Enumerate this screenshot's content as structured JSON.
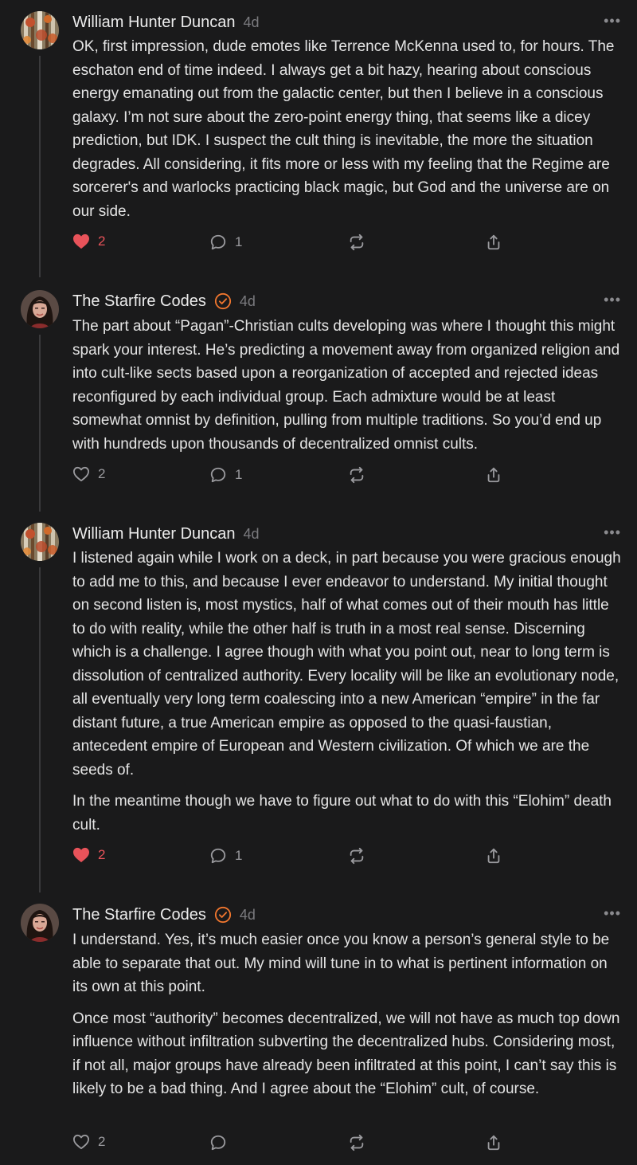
{
  "colors": {
    "background": "#1a1a1b",
    "like": "#e8535a",
    "verified": "#f0762e",
    "muted": "#9a9a9e"
  },
  "comments": [
    {
      "author": "William Hunter Duncan",
      "time": "4d",
      "verified": false,
      "paragraphs": [
        "OK, first impression, dude emotes like Terrence McKenna used to, for hours. The eschaton end of time indeed. I always get a bit hazy, hearing about conscious energy emanating out from the galactic center, but then I believe in a conscious galaxy. I’m not sure about the zero-point energy thing, that seems like a dicey prediction, but IDK. I suspect the cult thing is inevitable, the more the situation degrades. All considering, it fits more or less with my feeling that the Regime are sorcerer's and warlocks practicing black magic, but God and the universe are on our side."
      ],
      "likes": "2",
      "liked": true,
      "replies": "1"
    },
    {
      "author": "The Starfire Codes",
      "time": "4d",
      "verified": true,
      "paragraphs": [
        "The part about “Pagan”-Christian cults developing was where I thought this might spark your interest. He’s predicting a movement away from organized religion and into cult-like sects based upon a reorganization of accepted and rejected ideas reconfigured by each individual group. Each admixture would be at least somewhat omnist by definition, pulling from multiple traditions. So you’d end up with hundreds upon thousands of decentralized omnist cults."
      ],
      "likes": "2",
      "liked": false,
      "replies": "1"
    },
    {
      "author": "William Hunter Duncan",
      "time": "4d",
      "verified": false,
      "paragraphs": [
        "I listened again while I work on a deck, in part because you were gracious enough to add me to this, and because I ever endeavor to understand. My initial thought on second listen is, most mystics, half of what comes out of their mouth has little to do with reality, while the other half is truth in a most real sense. Discerning which is a challenge. I agree though with what you point out, near to long term is dissolution of centralized authority. Every locality will be like an evolutionary node, all eventually very long term coalescing into a new American “empire” in the far distant future, a true American empire as opposed to the quasi-faustian, antecedent empire of European and Western civilization. Of which we are the seeds of.",
        "In the meantime though we have to figure out what to do with this “Elohim” death cult."
      ],
      "likes": "2",
      "liked": true,
      "replies": "1"
    },
    {
      "author": "The Starfire Codes",
      "time": "4d",
      "verified": true,
      "paragraphs": [
        "I understand. Yes, it’s much easier once you know a person’s general style to be able to separate that out. My mind will tune in to what is pertinent information on its own at this point.",
        "Once most “authority” becomes decentralized, we will not have as much top down influence without infiltration subverting the decentralized hubs. Considering most, if not all, major groups have already been infiltrated at this point, I can’t say this is likely to be a bad thing. And I agree about the “Elohim” cult, of course."
      ],
      "likes": "2",
      "liked": false,
      "replies": ""
    }
  ]
}
